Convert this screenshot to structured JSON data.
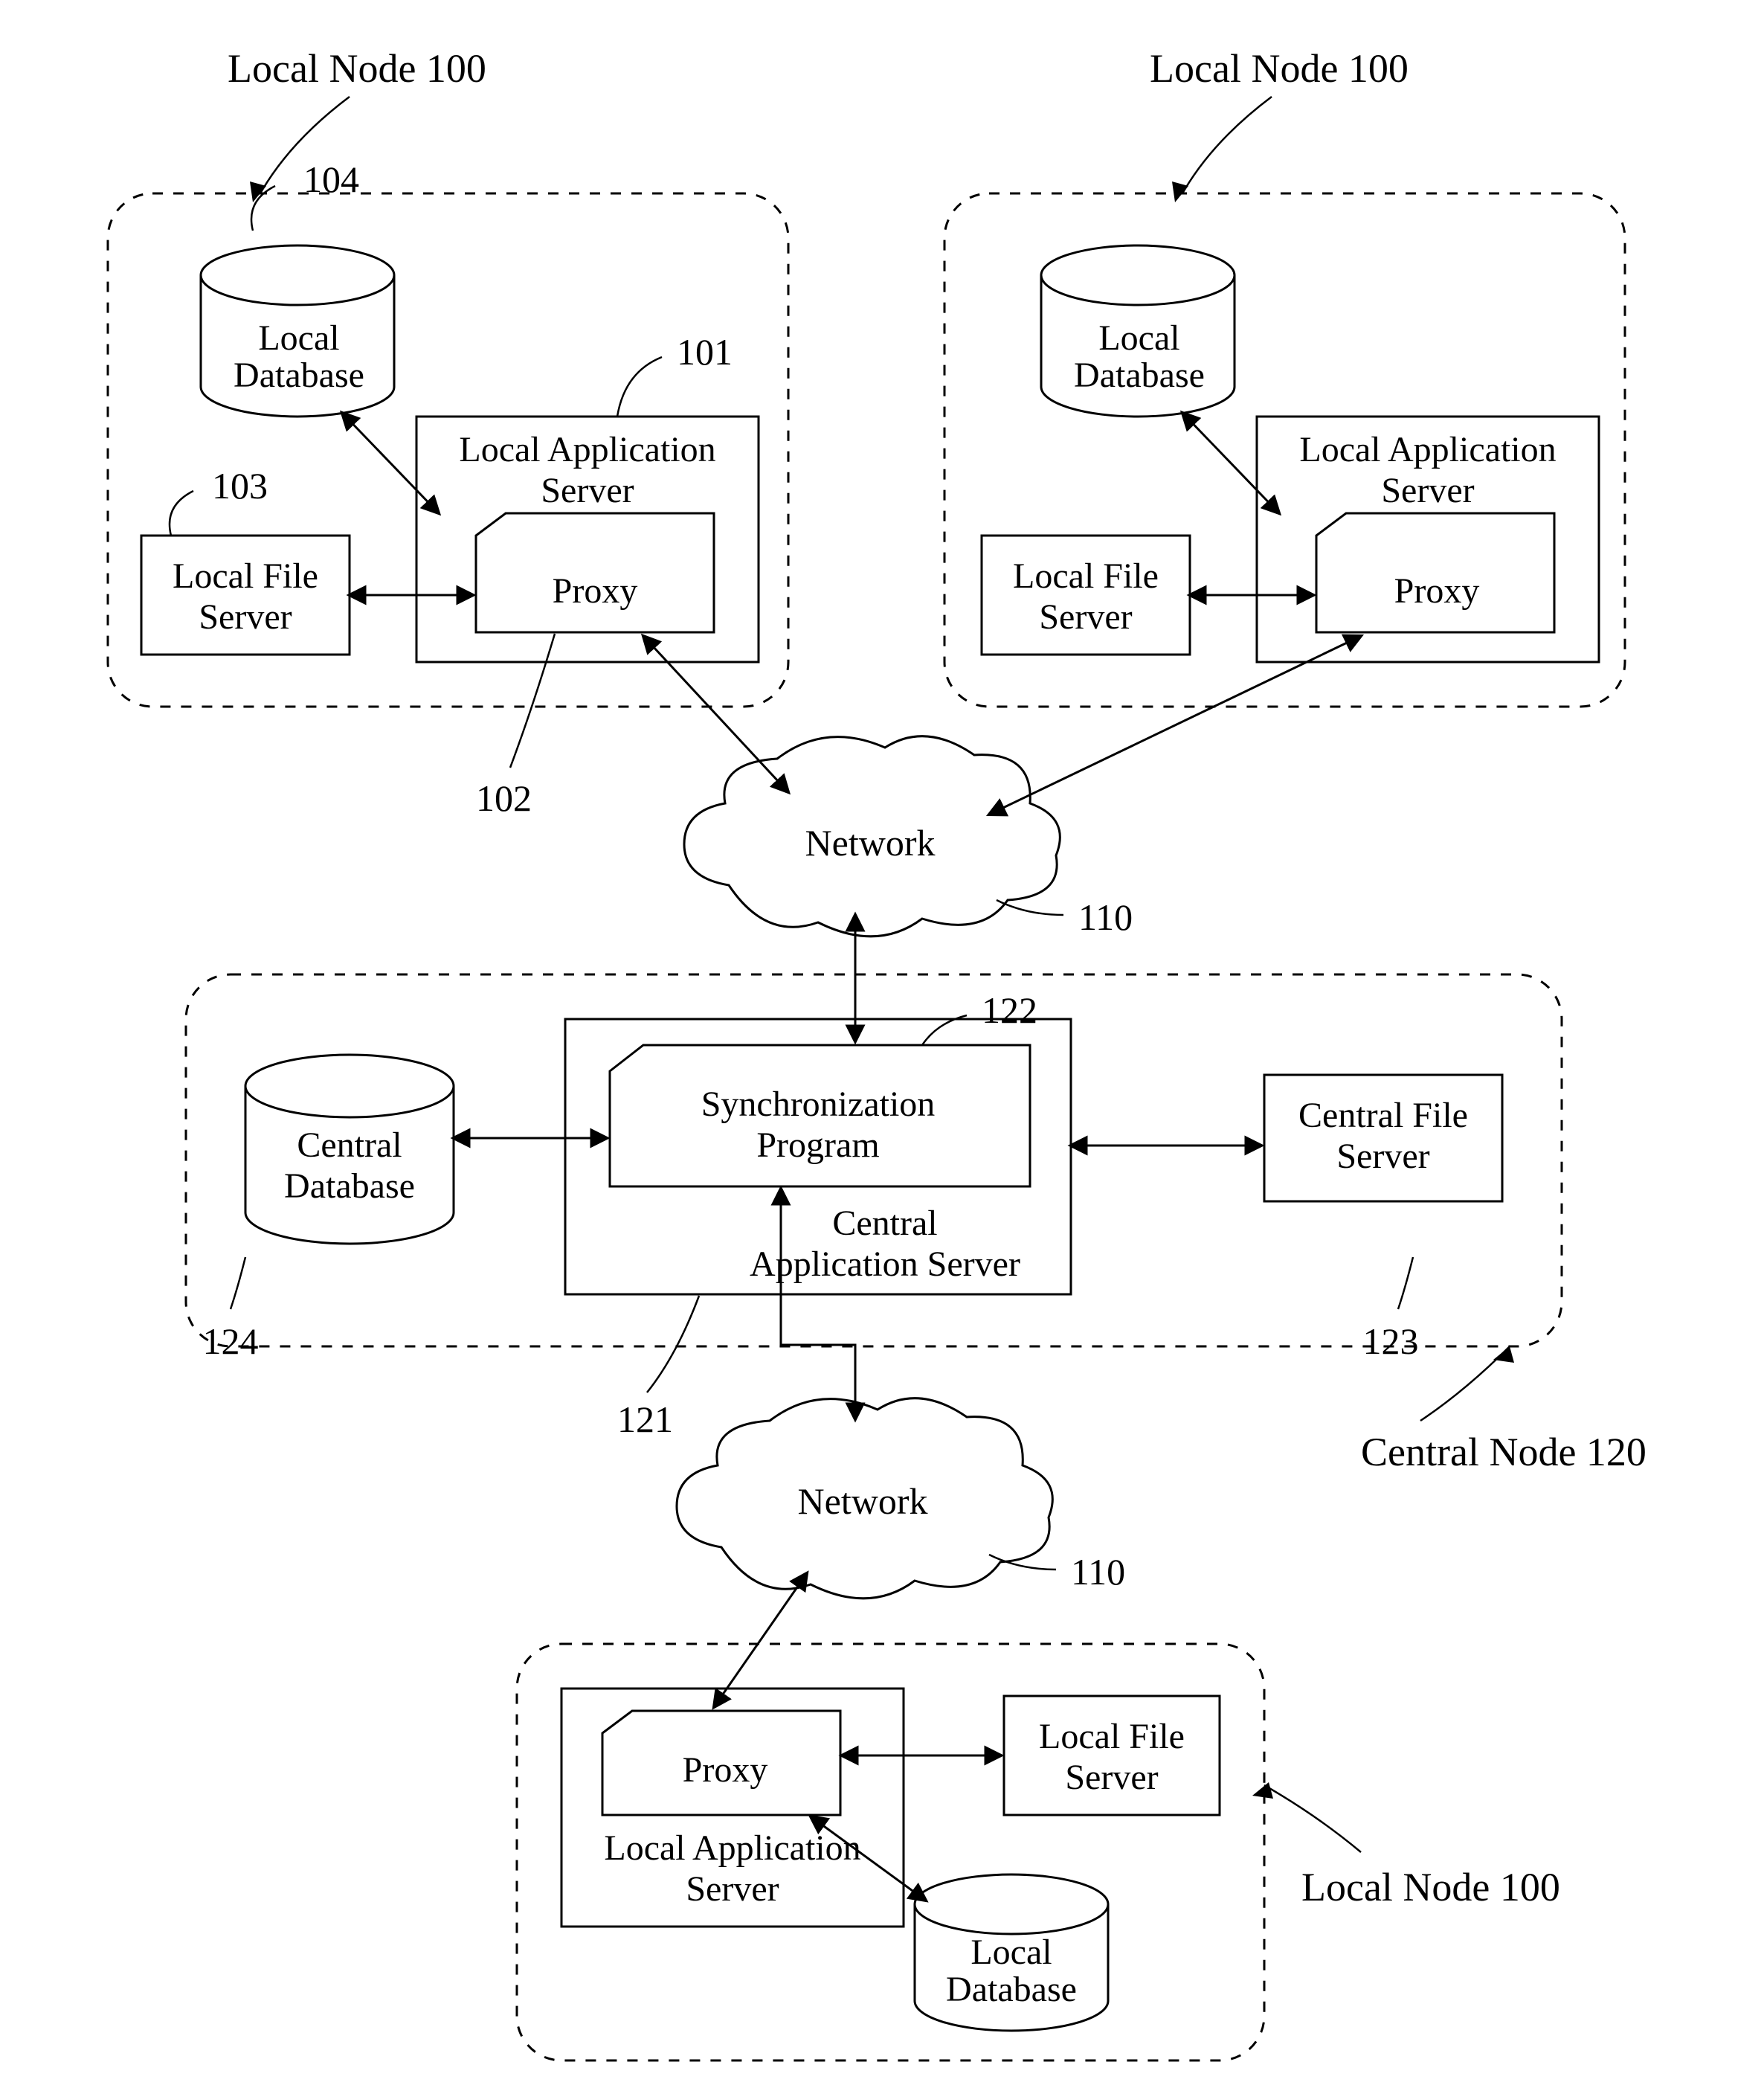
{
  "nodes": {
    "topLeft": {
      "title": "Local Node 100",
      "db": {
        "label": "Local\nDatabase",
        "ref": "104"
      },
      "appServer": {
        "label": "Local Application\nServer",
        "ref": "101"
      },
      "proxy": {
        "label": "Proxy",
        "ref": "102"
      },
      "fileServer": {
        "label": "Local File\nServer",
        "ref": "103"
      }
    },
    "topRight": {
      "title": "Local Node 100",
      "db": {
        "label": "Local\nDatabase"
      },
      "appServer": {
        "label": "Local Application\nServer"
      },
      "proxy": {
        "label": "Proxy"
      },
      "fileServer": {
        "label": "Local File\nServer"
      }
    },
    "central": {
      "title": "Central Node 120",
      "db": {
        "label": "Central\nDatabase",
        "ref": "124"
      },
      "appServer": {
        "label": "Central\nApplication Server",
        "ref": "121"
      },
      "sync": {
        "label": "Synchronization\nProgram",
        "ref": "122"
      },
      "fileServer": {
        "label": "Central File\nServer",
        "ref": "123"
      }
    },
    "bottom": {
      "title": "Local Node 100",
      "db": {
        "label": "Local\nDatabase"
      },
      "appServer": {
        "label": "Local Application\nServer"
      },
      "proxy": {
        "label": "Proxy"
      },
      "fileServer": {
        "label": "Local File\nServer"
      }
    }
  },
  "network": {
    "label": "Network",
    "ref": "110"
  }
}
